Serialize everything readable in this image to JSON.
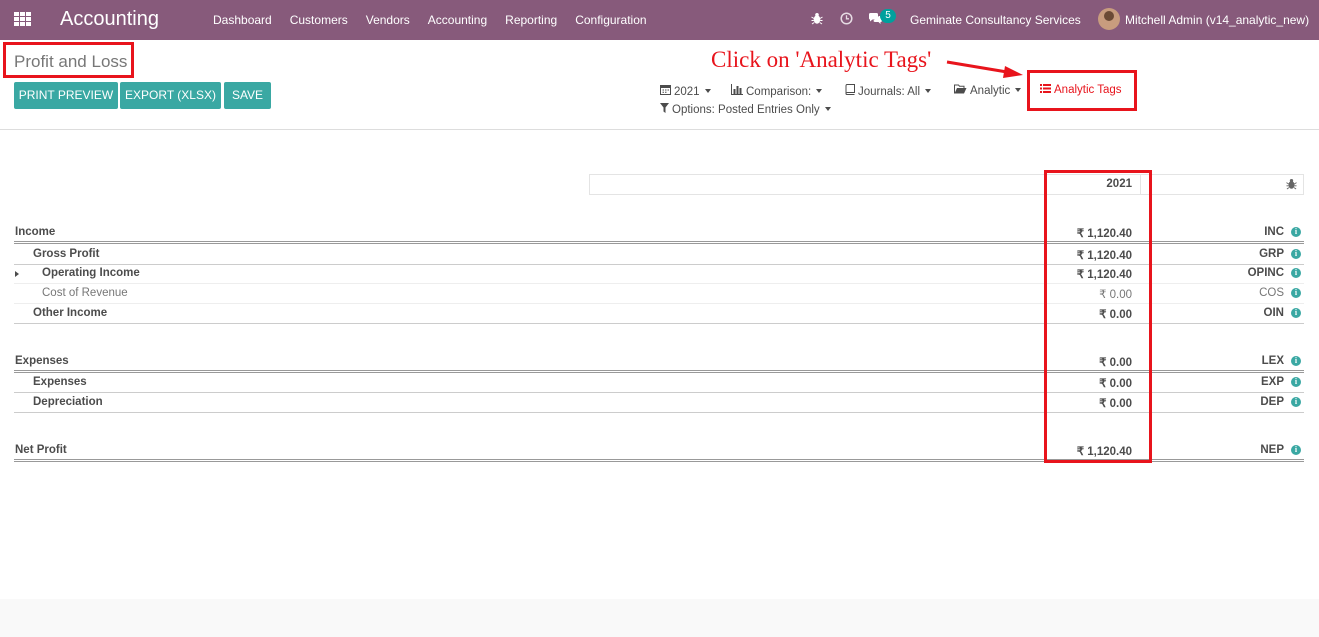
{
  "navbar": {
    "app_title": "Accounting",
    "menu": [
      "Dashboard",
      "Customers",
      "Vendors",
      "Accounting",
      "Reporting",
      "Configuration"
    ],
    "icons": {
      "debug": "bug-icon",
      "activity": "clock-icon",
      "messaging": "chat-icon"
    },
    "message_count": "5",
    "company": "Geminate Consultancy Services",
    "user": "Mitchell Admin (v14_analytic_new)"
  },
  "control_panel": {
    "title": "Profit and Loss",
    "buttons": {
      "print": "PRINT PREVIEW",
      "export": "EXPORT (XLSX)",
      "save": "SAVE"
    },
    "filters": {
      "date": "2021",
      "comparison": "Comparison:",
      "journals": "Journals: All",
      "analytic": "Analytic",
      "analytic_tags": "Analytic Tags",
      "options": "Options: Posted Entries Only"
    },
    "callout": "Click on 'Analytic Tags'"
  },
  "report": {
    "column_header": "2021",
    "rows": [
      {
        "label": "Income",
        "amount": "₹ 1,120.40",
        "code": "INC"
      },
      {
        "label": "Gross Profit",
        "amount": "₹ 1,120.40",
        "code": "GRP"
      },
      {
        "label": "Operating Income",
        "amount": "₹ 1,120.40",
        "code": "OPINC"
      },
      {
        "label": "Cost of Revenue",
        "amount": "₹ 0.00",
        "code": "COS"
      },
      {
        "label": "Other Income",
        "amount": "₹ 0.00",
        "code": "OIN"
      },
      {
        "label": "Expenses",
        "amount": "₹ 0.00",
        "code": "LEX"
      },
      {
        "label": "Expenses",
        "amount": "₹ 0.00",
        "code": "EXP"
      },
      {
        "label": "Depreciation",
        "amount": "₹ 0.00",
        "code": "DEP"
      },
      {
        "label": "Net Profit",
        "amount": "₹ 1,120.40",
        "code": "NEP"
      }
    ]
  },
  "colors": {
    "navbar": "#875a7b",
    "primary_button": "#3aa8a3",
    "annotation": "#e8141c"
  }
}
